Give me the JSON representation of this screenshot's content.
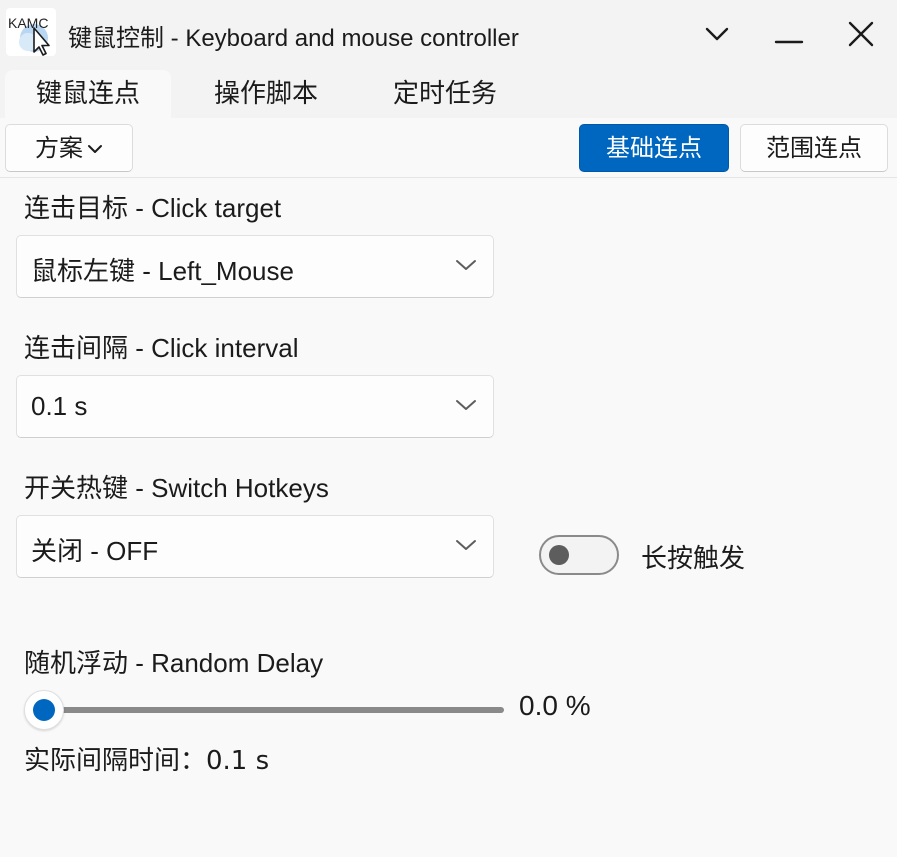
{
  "app": {
    "logo_text": "KAMC",
    "title": "键鼠控制 - Keyboard and mouse controller"
  },
  "tabs": [
    {
      "label": "键鼠连点",
      "active": true
    },
    {
      "label": "操作脚本",
      "active": false
    },
    {
      "label": "定时任务",
      "active": false
    }
  ],
  "toolbar": {
    "scheme_label": "方案",
    "basic_click_label": "基础连点",
    "range_click_label": "范围连点"
  },
  "click_target": {
    "label": "连击目标 - Click target",
    "value": "鼠标左键 - Left_Mouse"
  },
  "click_interval": {
    "label": "连击间隔 - Click interval",
    "value": "0.1 s"
  },
  "switch_hotkeys": {
    "label": "开关热键 - Switch Hotkeys",
    "value": "关闭 - OFF",
    "long_press_label": "长按触发",
    "long_press_on": false
  },
  "random_delay": {
    "label": "随机浮动 - Random Delay",
    "value_text": "0.0 %",
    "value": 0.0
  },
  "actual_interval": {
    "text": "实际间隔时间：0.1 s"
  },
  "colors": {
    "accent": "#0067c0",
    "background": "#f9f9f9",
    "titlebar": "#f3f3f3"
  }
}
